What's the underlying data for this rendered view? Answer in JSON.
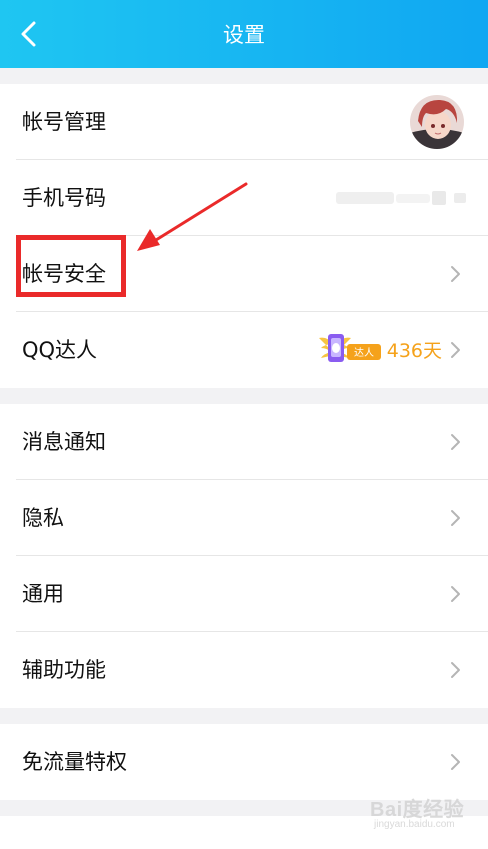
{
  "header": {
    "title": "设置"
  },
  "group1": {
    "items": [
      {
        "label": "帐号管理"
      },
      {
        "label": "手机号码"
      },
      {
        "label": "帐号安全"
      },
      {
        "label": "QQ达人",
        "badge_text": "达人",
        "value": "436天"
      }
    ]
  },
  "group2": {
    "items": [
      {
        "label": "消息通知"
      },
      {
        "label": "隐私"
      },
      {
        "label": "通用"
      },
      {
        "label": "辅助功能"
      }
    ]
  },
  "group3": {
    "items": [
      {
        "label": "免流量特权"
      }
    ]
  },
  "watermark": {
    "text": "Bai度经验",
    "sub": "jingyan.baidu.com"
  },
  "colors": {
    "header_gradient_start": "#1fc6f2",
    "header_gradient_end": "#10a7f2",
    "accent_orange": "#f5a21b",
    "annotation_red": "#ea2a2a",
    "page_bg": "#f2f2f4"
  }
}
